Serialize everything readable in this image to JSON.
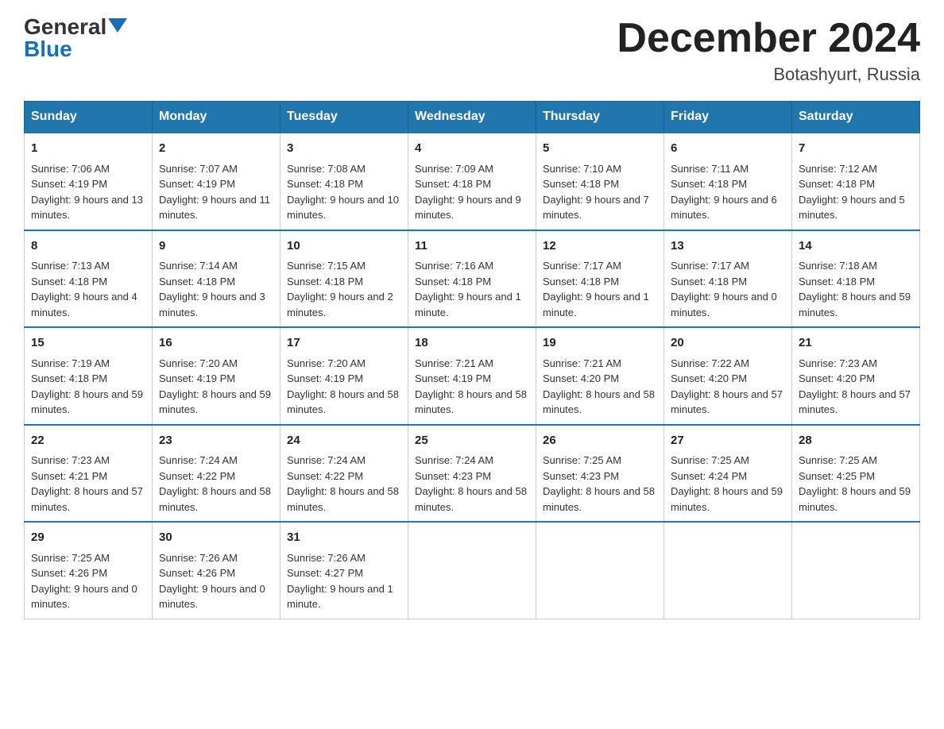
{
  "header": {
    "logo_general": "General",
    "logo_blue": "Blue",
    "month_title": "December 2024",
    "location": "Botashyurt, Russia"
  },
  "weekdays": [
    "Sunday",
    "Monday",
    "Tuesday",
    "Wednesday",
    "Thursday",
    "Friday",
    "Saturday"
  ],
  "weeks": [
    [
      {
        "day": "1",
        "sunrise": "7:06 AM",
        "sunset": "4:19 PM",
        "daylight": "9 hours and 13 minutes."
      },
      {
        "day": "2",
        "sunrise": "7:07 AM",
        "sunset": "4:19 PM",
        "daylight": "9 hours and 11 minutes."
      },
      {
        "day": "3",
        "sunrise": "7:08 AM",
        "sunset": "4:18 PM",
        "daylight": "9 hours and 10 minutes."
      },
      {
        "day": "4",
        "sunrise": "7:09 AM",
        "sunset": "4:18 PM",
        "daylight": "9 hours and 9 minutes."
      },
      {
        "day": "5",
        "sunrise": "7:10 AM",
        "sunset": "4:18 PM",
        "daylight": "9 hours and 7 minutes."
      },
      {
        "day": "6",
        "sunrise": "7:11 AM",
        "sunset": "4:18 PM",
        "daylight": "9 hours and 6 minutes."
      },
      {
        "day": "7",
        "sunrise": "7:12 AM",
        "sunset": "4:18 PM",
        "daylight": "9 hours and 5 minutes."
      }
    ],
    [
      {
        "day": "8",
        "sunrise": "7:13 AM",
        "sunset": "4:18 PM",
        "daylight": "9 hours and 4 minutes."
      },
      {
        "day": "9",
        "sunrise": "7:14 AM",
        "sunset": "4:18 PM",
        "daylight": "9 hours and 3 minutes."
      },
      {
        "day": "10",
        "sunrise": "7:15 AM",
        "sunset": "4:18 PM",
        "daylight": "9 hours and 2 minutes."
      },
      {
        "day": "11",
        "sunrise": "7:16 AM",
        "sunset": "4:18 PM",
        "daylight": "9 hours and 1 minute."
      },
      {
        "day": "12",
        "sunrise": "7:17 AM",
        "sunset": "4:18 PM",
        "daylight": "9 hours and 1 minute."
      },
      {
        "day": "13",
        "sunrise": "7:17 AM",
        "sunset": "4:18 PM",
        "daylight": "9 hours and 0 minutes."
      },
      {
        "day": "14",
        "sunrise": "7:18 AM",
        "sunset": "4:18 PM",
        "daylight": "8 hours and 59 minutes."
      }
    ],
    [
      {
        "day": "15",
        "sunrise": "7:19 AM",
        "sunset": "4:18 PM",
        "daylight": "8 hours and 59 minutes."
      },
      {
        "day": "16",
        "sunrise": "7:20 AM",
        "sunset": "4:19 PM",
        "daylight": "8 hours and 59 minutes."
      },
      {
        "day": "17",
        "sunrise": "7:20 AM",
        "sunset": "4:19 PM",
        "daylight": "8 hours and 58 minutes."
      },
      {
        "day": "18",
        "sunrise": "7:21 AM",
        "sunset": "4:19 PM",
        "daylight": "8 hours and 58 minutes."
      },
      {
        "day": "19",
        "sunrise": "7:21 AM",
        "sunset": "4:20 PM",
        "daylight": "8 hours and 58 minutes."
      },
      {
        "day": "20",
        "sunrise": "7:22 AM",
        "sunset": "4:20 PM",
        "daylight": "8 hours and 57 minutes."
      },
      {
        "day": "21",
        "sunrise": "7:23 AM",
        "sunset": "4:20 PM",
        "daylight": "8 hours and 57 minutes."
      }
    ],
    [
      {
        "day": "22",
        "sunrise": "7:23 AM",
        "sunset": "4:21 PM",
        "daylight": "8 hours and 57 minutes."
      },
      {
        "day": "23",
        "sunrise": "7:24 AM",
        "sunset": "4:22 PM",
        "daylight": "8 hours and 58 minutes."
      },
      {
        "day": "24",
        "sunrise": "7:24 AM",
        "sunset": "4:22 PM",
        "daylight": "8 hours and 58 minutes."
      },
      {
        "day": "25",
        "sunrise": "7:24 AM",
        "sunset": "4:23 PM",
        "daylight": "8 hours and 58 minutes."
      },
      {
        "day": "26",
        "sunrise": "7:25 AM",
        "sunset": "4:23 PM",
        "daylight": "8 hours and 58 minutes."
      },
      {
        "day": "27",
        "sunrise": "7:25 AM",
        "sunset": "4:24 PM",
        "daylight": "8 hours and 59 minutes."
      },
      {
        "day": "28",
        "sunrise": "7:25 AM",
        "sunset": "4:25 PM",
        "daylight": "8 hours and 59 minutes."
      }
    ],
    [
      {
        "day": "29",
        "sunrise": "7:25 AM",
        "sunset": "4:26 PM",
        "daylight": "9 hours and 0 minutes."
      },
      {
        "day": "30",
        "sunrise": "7:26 AM",
        "sunset": "4:26 PM",
        "daylight": "9 hours and 0 minutes."
      },
      {
        "day": "31",
        "sunrise": "7:26 AM",
        "sunset": "4:27 PM",
        "daylight": "9 hours and 1 minute."
      },
      null,
      null,
      null,
      null
    ]
  ],
  "labels": {
    "sunrise": "Sunrise:",
    "sunset": "Sunset:",
    "daylight": "Daylight:"
  }
}
